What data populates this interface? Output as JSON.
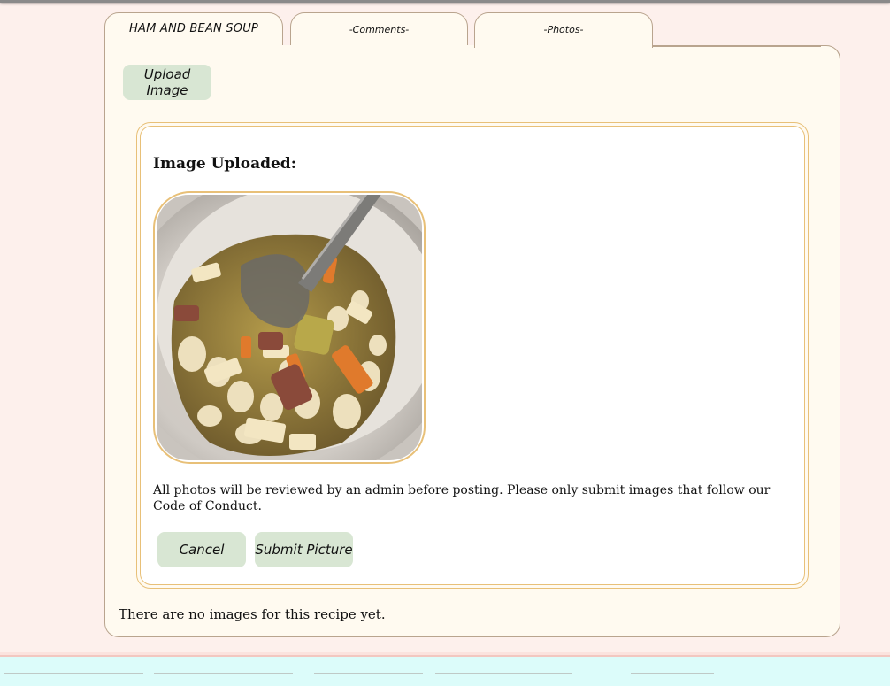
{
  "tabs": [
    {
      "label": "HAM AND BEAN SOUP"
    },
    {
      "label": "-Comments-"
    },
    {
      "label": "-Photos-"
    }
  ],
  "toolbar": {
    "upload_label": "Upload Image"
  },
  "upload_card": {
    "title": "Image Uploaded:",
    "photo_alt": "Uploaded photo of ham and bean soup in a white bowl with a spoon",
    "notice": "All photos will be reviewed by an admin before posting. Please only submit images that follow our Code of Conduct.",
    "cancel_label": "Cancel",
    "submit_label": "Submit Picture"
  },
  "gallery": {
    "empty_message": "There are no images for this recipe yet."
  },
  "colors": {
    "page_bg": "#fdf0ec",
    "panel_bg": "#fffaf0",
    "button_bg": "#d8e6d3",
    "card_border": "#e8c078",
    "tab_border": "#b9a48e",
    "footer_bg": "#dcfcfa"
  }
}
